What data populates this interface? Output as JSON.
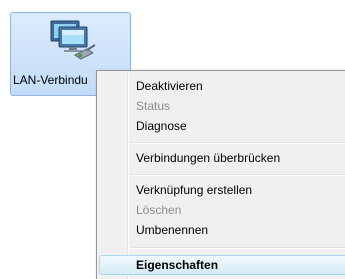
{
  "file_item": {
    "label": "LAN-Verbindu",
    "icon": "network-connection-icon"
  },
  "context_menu": {
    "items": [
      {
        "label": "Deaktivieren",
        "enabled": true
      },
      {
        "label": "Status",
        "enabled": false
      },
      {
        "label": "Diagnose",
        "enabled": true
      },
      {
        "label": "Verbindungen überbrücken",
        "enabled": true
      },
      {
        "label": "Verknüpfung erstellen",
        "enabled": true
      },
      {
        "label": "Löschen",
        "enabled": false
      },
      {
        "label": "Umbenennen",
        "enabled": true
      },
      {
        "label": "Eigenschaften",
        "enabled": true,
        "default": true,
        "highlighted": true
      }
    ]
  },
  "colors": {
    "selection_border": "#8fb4de",
    "selection_fill": "#c3dcf8",
    "menu_background": "#f0f0f0",
    "menu_border": "#979797",
    "highlight_border": "#a8d8eb",
    "disabled_text": "#8d8d8d"
  }
}
